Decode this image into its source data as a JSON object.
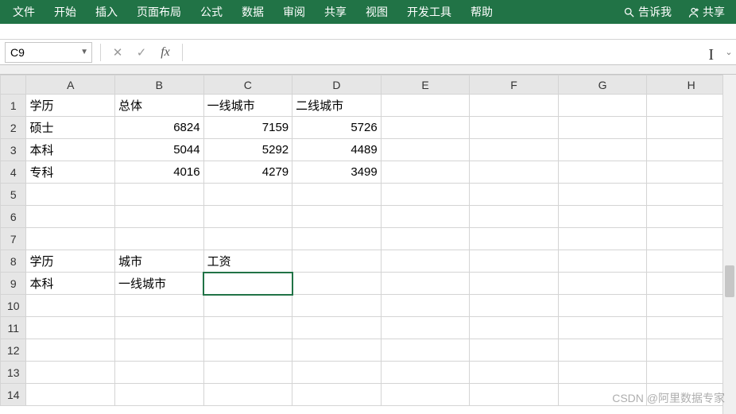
{
  "ribbon": {
    "tabs": [
      "文件",
      "开始",
      "插入",
      "页面布局",
      "公式",
      "数据",
      "审阅",
      "共享",
      "视图",
      "开发工具",
      "帮助"
    ],
    "tell_me": "告诉我",
    "share": "共享"
  },
  "formula_bar": {
    "name_box": "C9",
    "cancel": "✕",
    "confirm": "✓",
    "fx": "fx",
    "input_value": ""
  },
  "columns": [
    "A",
    "B",
    "C",
    "D",
    "E",
    "F",
    "G",
    "H"
  ],
  "row_count": 14,
  "selected": {
    "row": 9,
    "col": 2
  },
  "cells": {
    "1": {
      "A": {
        "v": "学历",
        "t": "txt"
      },
      "B": {
        "v": "总体",
        "t": "txt"
      },
      "C": {
        "v": "一线城市",
        "t": "txt"
      },
      "D": {
        "v": "二线城市",
        "t": "txt"
      }
    },
    "2": {
      "A": {
        "v": "硕士",
        "t": "txt"
      },
      "B": {
        "v": "6824",
        "t": "num"
      },
      "C": {
        "v": "7159",
        "t": "num"
      },
      "D": {
        "v": "5726",
        "t": "num"
      }
    },
    "3": {
      "A": {
        "v": "本科",
        "t": "txt"
      },
      "B": {
        "v": "5044",
        "t": "num"
      },
      "C": {
        "v": "5292",
        "t": "num"
      },
      "D": {
        "v": "4489",
        "t": "num"
      }
    },
    "4": {
      "A": {
        "v": "专科",
        "t": "txt"
      },
      "B": {
        "v": "4016",
        "t": "num"
      },
      "C": {
        "v": "4279",
        "t": "num"
      },
      "D": {
        "v": "3499",
        "t": "num"
      }
    },
    "8": {
      "A": {
        "v": "学历",
        "t": "txt"
      },
      "B": {
        "v": "城市",
        "t": "txt"
      },
      "C": {
        "v": "工资",
        "t": "txt"
      }
    },
    "9": {
      "A": {
        "v": "本科",
        "t": "txt"
      },
      "B": {
        "v": "一线城市",
        "t": "txt"
      }
    }
  },
  "watermark": "CSDN @阿里数据专家"
}
